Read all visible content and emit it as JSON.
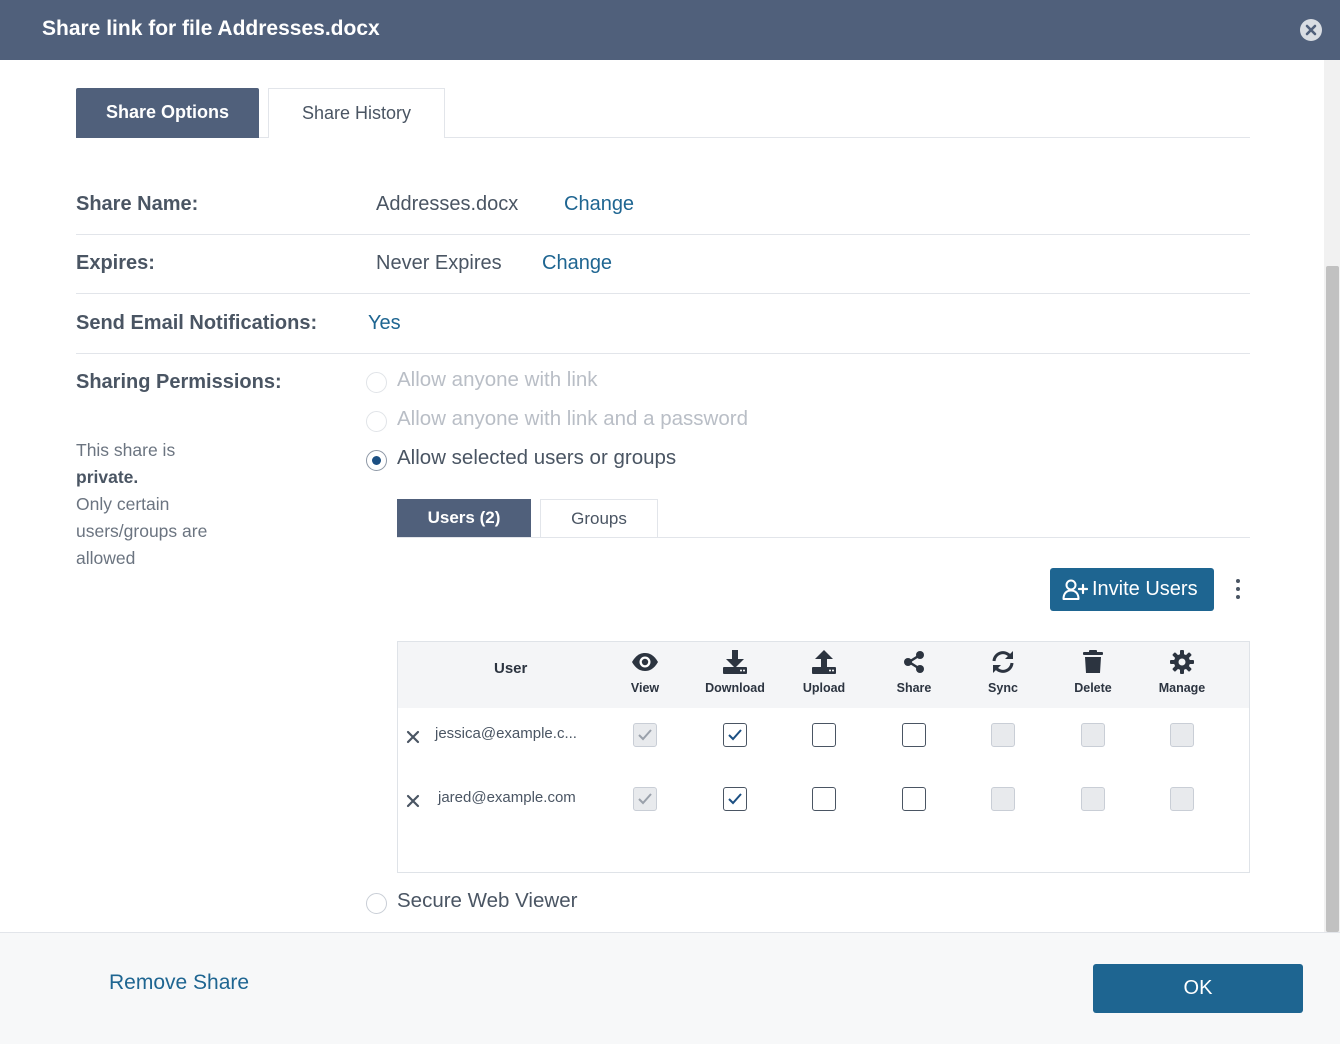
{
  "dialog": {
    "title": "Share link for file Addresses.docx"
  },
  "tabs": [
    {
      "label": "Share Options",
      "active": true
    },
    {
      "label": "Share History",
      "active": false
    }
  ],
  "share_name": {
    "label": "Share Name:",
    "value": "Addresses.docx",
    "action": "Change"
  },
  "expires": {
    "label": "Expires:",
    "value": "Never Expires",
    "action": "Change"
  },
  "email_notifications": {
    "label": "Send Email Notifications:",
    "value": "Yes"
  },
  "permissions": {
    "label": "Sharing Permissions:",
    "note_line1": "This share is",
    "note_bold": "private.",
    "note_rest": "Only certain users/groups are allowed",
    "options": [
      {
        "label": "Allow anyone with link",
        "state": "disabled"
      },
      {
        "label": "Allow anyone with link and a password",
        "state": "disabled"
      },
      {
        "label": "Allow selected users or groups",
        "state": "checked"
      }
    ],
    "secure_viewer": "Secure Web Viewer"
  },
  "sub_tabs": [
    {
      "label": "Users (2)",
      "active": true
    },
    {
      "label": "Groups",
      "active": false
    }
  ],
  "invite_button": "Invite Users",
  "table": {
    "user_header": "User",
    "columns": [
      {
        "label": "View",
        "icon": "eye-icon"
      },
      {
        "label": "Download",
        "icon": "download-icon"
      },
      {
        "label": "Upload",
        "icon": "upload-icon"
      },
      {
        "label": "Share",
        "icon": "share-icon"
      },
      {
        "label": "Sync",
        "icon": "sync-icon"
      },
      {
        "label": "Delete",
        "icon": "trash-icon"
      },
      {
        "label": "Manage",
        "icon": "gear-icon"
      }
    ],
    "rows": [
      {
        "email": "jessica@example.c...",
        "perms": [
          "checked-disabled",
          "checked",
          "unchecked",
          "unchecked",
          "disabled",
          "disabled",
          "disabled"
        ]
      },
      {
        "email": "jared@example.com",
        "perms": [
          "checked-disabled",
          "checked",
          "unchecked",
          "unchecked",
          "disabled",
          "disabled",
          "disabled"
        ]
      }
    ]
  },
  "footer": {
    "remove_share": "Remove Share",
    "ok": "OK"
  },
  "colors": {
    "header": "#50607b",
    "accent": "#1e6591",
    "text": "#4a5563"
  }
}
